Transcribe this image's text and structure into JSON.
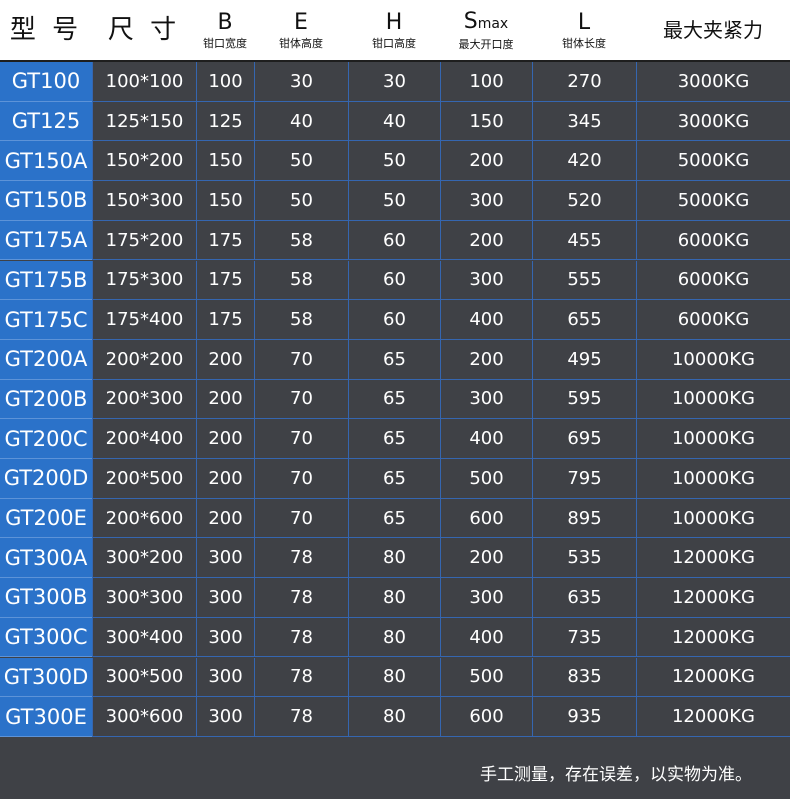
{
  "header": {
    "model": "型 号",
    "size": "尺 寸",
    "b": {
      "main": "B",
      "sub": "钳口宽度"
    },
    "e": {
      "main": "E",
      "sub": "钳体高度"
    },
    "h": {
      "main": "H",
      "sub": "钳口高度"
    },
    "s": {
      "main": "S",
      "main_sub": "max",
      "sub": "最大开口度"
    },
    "l": {
      "main": "L",
      "sub": "钳体长度"
    },
    "force": "最大夹紧力"
  },
  "rows": [
    [
      "GT100",
      "100*100",
      "100",
      "30",
      "30",
      "100",
      "270",
      "3000KG"
    ],
    [
      "GT125",
      "125*150",
      "125",
      "40",
      "40",
      "150",
      "345",
      "3000KG"
    ],
    [
      "GT150A",
      "150*200",
      "150",
      "50",
      "50",
      "200",
      "420",
      "5000KG"
    ],
    [
      "GT150B",
      "150*300",
      "150",
      "50",
      "50",
      "300",
      "520",
      "5000KG"
    ],
    [
      "GT175A",
      "175*200",
      "175",
      "58",
      "60",
      "200",
      "455",
      "6000KG"
    ],
    [
      "GT175B",
      "175*300",
      "175",
      "58",
      "60",
      "300",
      "555",
      "6000KG"
    ],
    [
      "GT175C",
      "175*400",
      "175",
      "58",
      "60",
      "400",
      "655",
      "6000KG"
    ],
    [
      "GT200A",
      "200*200",
      "200",
      "70",
      "65",
      "200",
      "495",
      "10000KG"
    ],
    [
      "GT200B",
      "200*300",
      "200",
      "70",
      "65",
      "300",
      "595",
      "10000KG"
    ],
    [
      "GT200C",
      "200*400",
      "200",
      "70",
      "65",
      "400",
      "695",
      "10000KG"
    ],
    [
      "GT200D",
      "200*500",
      "200",
      "70",
      "65",
      "500",
      "795",
      "10000KG"
    ],
    [
      "GT200E",
      "200*600",
      "200",
      "70",
      "65",
      "600",
      "895",
      "10000KG"
    ],
    [
      "GT300A",
      "300*200",
      "300",
      "78",
      "80",
      "200",
      "535",
      "12000KG"
    ],
    [
      "GT300B",
      "300*300",
      "300",
      "78",
      "80",
      "300",
      "635",
      "12000KG"
    ],
    [
      "GT300C",
      "300*400",
      "300",
      "78",
      "80",
      "400",
      "735",
      "12000KG"
    ],
    [
      "GT300D",
      "300*500",
      "300",
      "78",
      "80",
      "500",
      "835",
      "12000KG"
    ],
    [
      "GT300E",
      "300*600",
      "300",
      "78",
      "80",
      "600",
      "935",
      "12000KG"
    ]
  ],
  "note": "手工测量，存在误差，以实物为准。",
  "colors": {
    "model_bg": "#2b72c9",
    "body_bg": "#3f4146",
    "header_bg": "#ffffff"
  }
}
